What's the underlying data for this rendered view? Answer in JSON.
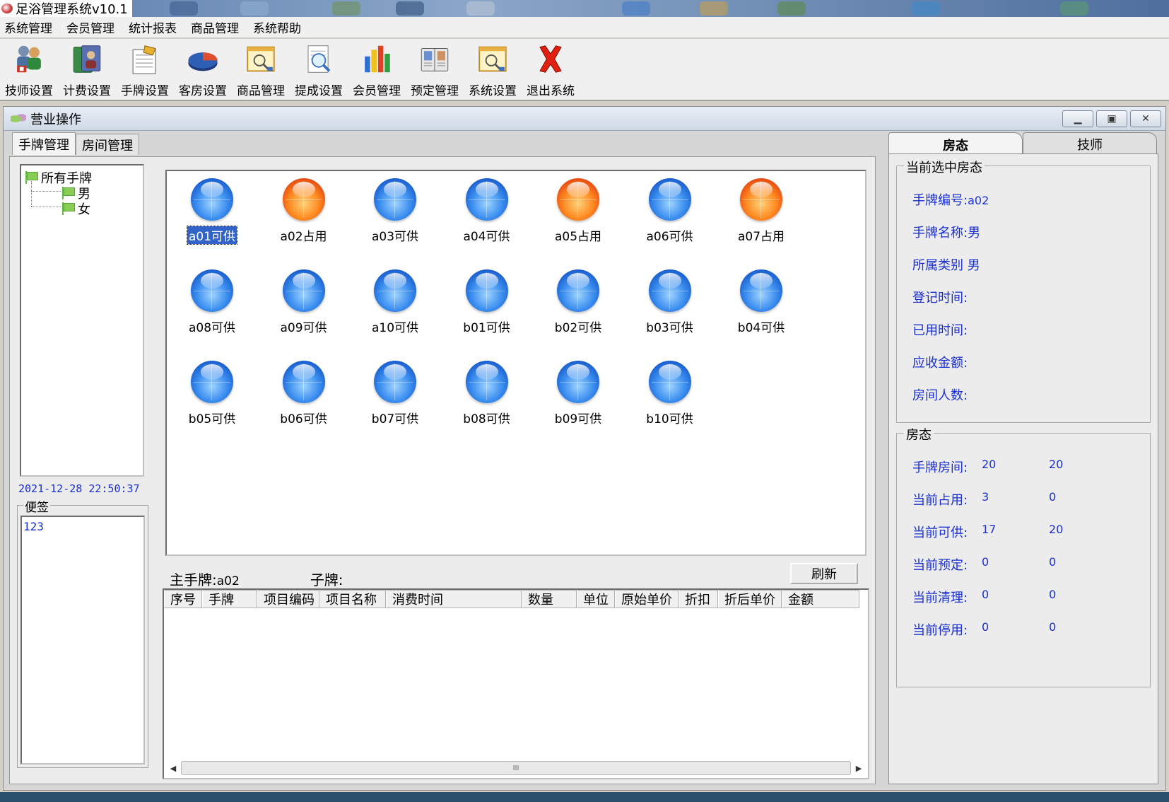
{
  "app": {
    "title": "足浴管理系统v10.1"
  },
  "menu": [
    "系统管理",
    "会员管理",
    "统计报表",
    "商品管理",
    "系统帮助"
  ],
  "toolbar": [
    {
      "label": "技师设置",
      "icon": "technician-settings-icon"
    },
    {
      "label": "计费设置",
      "icon": "billing-settings-icon"
    },
    {
      "label": "手牌设置",
      "icon": "hand-tag-settings-icon"
    },
    {
      "label": "客房设置",
      "icon": "guest-room-settings-icon"
    },
    {
      "label": "商品管理",
      "icon": "product-management-icon"
    },
    {
      "label": "提成设置",
      "icon": "commission-settings-icon"
    },
    {
      "label": "会员管理",
      "icon": "member-management-icon"
    },
    {
      "label": "预定管理",
      "icon": "reservation-management-icon"
    },
    {
      "label": "系统设置",
      "icon": "system-settings-icon"
    },
    {
      "label": "退出系统",
      "icon": "exit-system-icon"
    }
  ],
  "window": {
    "title": "营业操作",
    "tabs": [
      "手牌管理",
      "房间管理"
    ],
    "tree": {
      "root": "所有手牌",
      "children": [
        "男",
        "女"
      ]
    },
    "datetime": "2021-12-28 22:50:37",
    "notes": {
      "label": "便签",
      "text": "123"
    },
    "tags": [
      {
        "label": "a01可供",
        "status": "available",
        "selected": true
      },
      {
        "label": "a02占用",
        "status": "occupied"
      },
      {
        "label": "a03可供",
        "status": "available"
      },
      {
        "label": "a04可供",
        "status": "available"
      },
      {
        "label": "a05占用",
        "status": "occupied"
      },
      {
        "label": "a06可供",
        "status": "available"
      },
      {
        "label": "a07占用",
        "status": "occupied"
      },
      {
        "label": "a08可供",
        "status": "available"
      },
      {
        "label": "a09可供",
        "status": "available"
      },
      {
        "label": "a10可供",
        "status": "available"
      },
      {
        "label": "b01可供",
        "status": "available"
      },
      {
        "label": "b02可供",
        "status": "available"
      },
      {
        "label": "b03可供",
        "status": "available"
      },
      {
        "label": "b04可供",
        "status": "available"
      },
      {
        "label": "b05可供",
        "status": "available"
      },
      {
        "label": "b06可供",
        "status": "available"
      },
      {
        "label": "b07可供",
        "status": "available"
      },
      {
        "label": "b08可供",
        "status": "available"
      },
      {
        "label": "b09可供",
        "status": "available"
      },
      {
        "label": "b10可供",
        "status": "available"
      }
    ],
    "main_tag": {
      "label": "主手牌:",
      "value": "a02"
    },
    "sub_tag": {
      "label": "子牌:",
      "value": ""
    },
    "refresh_label": "刷新",
    "columns": [
      "序号",
      "手牌",
      "项目编码",
      "项目名称",
      "消费时间",
      "数量",
      "单位",
      "原始单价",
      "折扣",
      "折后单价",
      "金额"
    ],
    "scroll_grip": "III"
  },
  "right": {
    "tabs": [
      "房态",
      "技师"
    ],
    "current": {
      "legend": "当前选中房态",
      "rows": [
        {
          "label": "手牌编号:",
          "value": "a02"
        },
        {
          "label": "手牌名称:",
          "value": "男"
        },
        {
          "label": "所属类别",
          "value": "男"
        },
        {
          "label": "登记时间:",
          "value": ""
        },
        {
          "label": "已用时间:",
          "value": ""
        },
        {
          "label": "应收金额:",
          "value": ""
        },
        {
          "label": "房间人数:",
          "value": ""
        }
      ]
    },
    "status": {
      "legend": "房态",
      "rows": [
        {
          "label": "手牌房间:",
          "v1": "20",
          "v2": "20"
        },
        {
          "label": "当前占用:",
          "v1": "3",
          "v2": "0"
        },
        {
          "label": "当前可供:",
          "v1": "17",
          "v2": "20"
        },
        {
          "label": "当前预定:",
          "v1": "0",
          "v2": "0"
        },
        {
          "label": "当前清理:",
          "v1": "0",
          "v2": "0"
        },
        {
          "label": "当前停用:",
          "v1": "0",
          "v2": "0"
        }
      ]
    }
  },
  "colors": {
    "blue_text": "#1a2fd0",
    "available": "#3c8ff0",
    "occupied": "#ff8a21",
    "selection": "#3163c9"
  }
}
